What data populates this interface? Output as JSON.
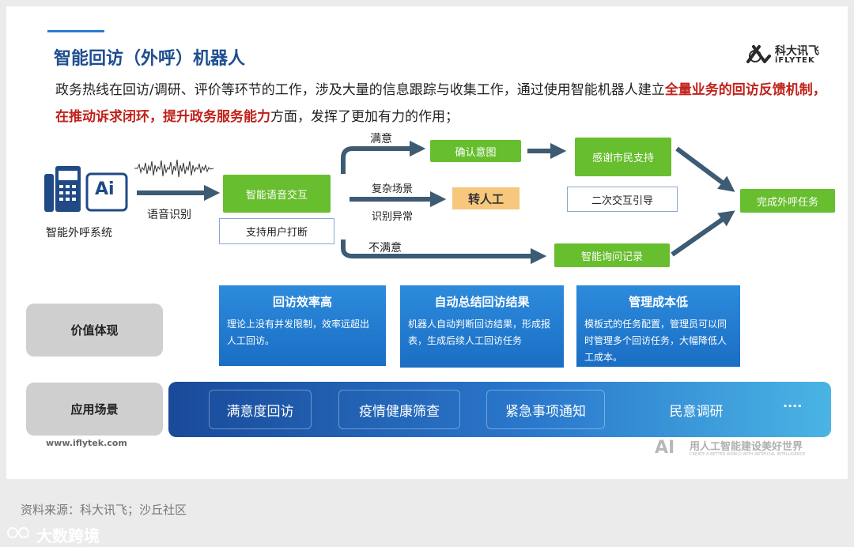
{
  "title": "智能回访（外呼）机器人",
  "logo": {
    "main": "科大讯飞",
    "sub": "iFLYTEK"
  },
  "intro": {
    "part1": "政务热线在回访/调研、评价等环节的工作，涉及大量的信息跟踪与收集工作，通过使用智能机器人建立",
    "highlight1": "全量业务的回访反馈机制，在推动诉求闭环，提升政务服务能力",
    "part2": "方面，发挥了更加有力的作用；"
  },
  "flow": {
    "system_label": "智能外呼系统",
    "ai_icon_text": "Ai",
    "speech_label": "语音识别",
    "voice_interact": "智能语音交互",
    "interrupt": "支持用户打断",
    "satisfied": "满意",
    "confirm": "确认意图",
    "thanks": "感谢市民支持",
    "second": "二次交互引导",
    "complex": "复杂场景",
    "abnormal": "识别异常",
    "transfer": "转人工",
    "unsatisfied": "不满意",
    "query_record": "智能询问记录",
    "complete": "完成外呼任务"
  },
  "value": {
    "label": "价值体现",
    "cards": [
      {
        "title": "回访效率高",
        "body": "理论上没有并发限制，效率远超出人工回访。"
      },
      {
        "title": "自动总结回访结果",
        "body": "机器人自动判断回访结果，形成报表，生成后续人工回访任务"
      },
      {
        "title": "管理成本低",
        "body": "模板式的任务配置，管理员可以同时管理多个回访任务，大幅降低人工成本。"
      }
    ]
  },
  "scenes": {
    "label": "应用场景",
    "items": [
      "满意度回访",
      "疫情健康筛查",
      "紧急事项通知",
      "民意调研"
    ],
    "more": "····"
  },
  "url": "www.iflytek.com",
  "slogan": {
    "ai": "AI",
    "main": "用人工智能建设美好世界",
    "sub": "CREATE A BETTER WORLD WITH ARTIFICIAL INTELLIGENCE"
  },
  "source": "资料来源：科大讯飞；沙丘社区",
  "watermark": "大数跨境",
  "colors": {
    "accent": "#1d4e8f",
    "highlight": "#c0221b",
    "green": "#67be2e",
    "arrow": "#3d5b73"
  }
}
